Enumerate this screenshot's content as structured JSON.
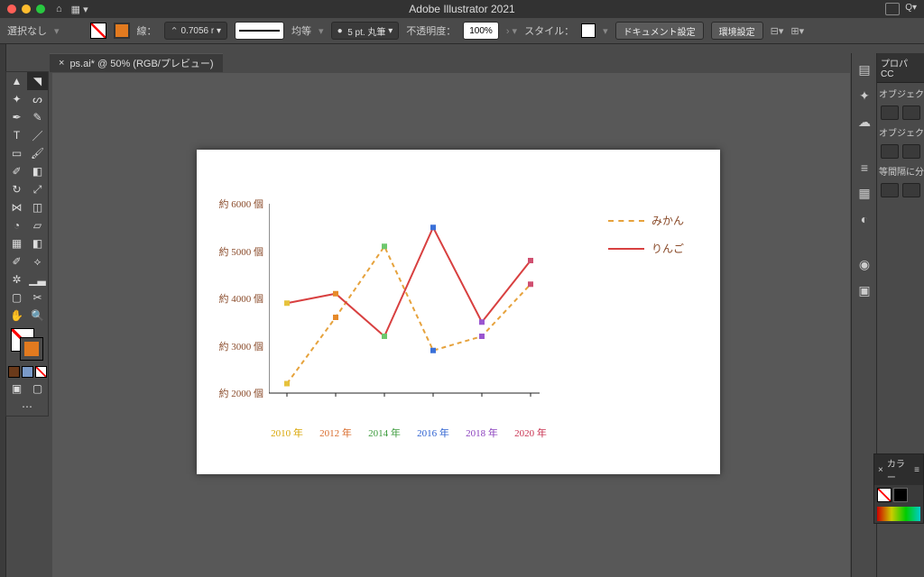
{
  "titlebar": {
    "title": "Adobe Illustrator 2021"
  },
  "ctrlbar": {
    "select_label": "選択なし",
    "stroke_label": "線：",
    "stroke_width": "0.7056 r",
    "uniform": "均等",
    "brush": "5 pt. 丸筆",
    "opacity_label": "不透明度：",
    "opacity_value": "100%",
    "style_label": "スタイル：",
    "doc_setup": "ドキュメント設定",
    "prefs": "環境設定"
  },
  "doctab": {
    "close": "×",
    "label": "ps.ai* @ 50% (RGB/プレビュー)"
  },
  "prop_panel": {
    "header": "プロパ  CC",
    "section1": "オブジェク",
    "section2": "オブジェク",
    "section3": "等間隔に分"
  },
  "color_panel": {
    "label": "カラー"
  },
  "chart_data": {
    "type": "line",
    "title": "",
    "xlabel": "",
    "ylabel": "",
    "ylim": [
      2000,
      6000
    ],
    "y_ticks": [
      {
        "v": 2000,
        "label": "約 2000 個"
      },
      {
        "v": 3000,
        "label": "約 3000 個"
      },
      {
        "v": 4000,
        "label": "約 4000 個"
      },
      {
        "v": 5000,
        "label": "約 5000 個"
      },
      {
        "v": 6000,
        "label": "約 6000 個"
      }
    ],
    "x_ticks": [
      {
        "label": "2010 年",
        "color": "#d8a400"
      },
      {
        "label": "2012 年",
        "color": "#d86a2a"
      },
      {
        "label": "2014 年",
        "color": "#3a9a3a"
      },
      {
        "label": "2016 年",
        "color": "#2a5fd0"
      },
      {
        "label": "2018 年",
        "color": "#8a3fbd"
      },
      {
        "label": "2020 年",
        "color": "#c8304f"
      }
    ],
    "series": [
      {
        "name": "みかん",
        "style": "dash",
        "color": "#e6a23c",
        "marker_colors": [
          "#e6c23c",
          "#e68a2a",
          "#6ec86e",
          "#3a70d8",
          "#9a56d0",
          "#d05070"
        ],
        "values": [
          2200,
          3600,
          5100,
          2900,
          3200,
          4300
        ]
      },
      {
        "name": "りんご",
        "style": "solid",
        "color": "#d84040",
        "marker_colors": [
          "#e6c23c",
          "#e68a2a",
          "#6ec86e",
          "#3a70d8",
          "#9a56d0",
          "#d05070"
        ],
        "values": [
          3900,
          4100,
          3200,
          5500,
          3500,
          4800
        ]
      }
    ],
    "legend": {
      "position": "right"
    }
  }
}
